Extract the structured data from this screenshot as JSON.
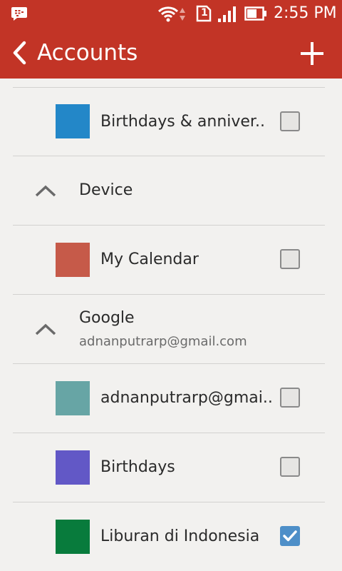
{
  "status": {
    "time": "2:55 PM",
    "sim_number": "1"
  },
  "appbar": {
    "title": "Accounts"
  },
  "colors": {
    "primary": "#c23426",
    "checked": "#4e8fc8"
  },
  "items": [
    {
      "type": "calendar",
      "label": "Birthdays & anniver..",
      "color": "#2387c8",
      "checked": false
    },
    {
      "type": "group",
      "label": "Device",
      "sub": ""
    },
    {
      "type": "calendar",
      "label": "My Calendar",
      "color": "#c65a49",
      "checked": false
    },
    {
      "type": "group",
      "label": "Google",
      "sub": "adnanputrarp@gmail.com"
    },
    {
      "type": "calendar",
      "label": "adnanputrarp@gmai..",
      "color": "#67a5a5",
      "checked": false
    },
    {
      "type": "calendar",
      "label": "Birthdays",
      "color": "#6258c6",
      "checked": false
    },
    {
      "type": "calendar",
      "label": "Liburan di Indonesia",
      "color": "#087b3c",
      "checked": true
    }
  ]
}
